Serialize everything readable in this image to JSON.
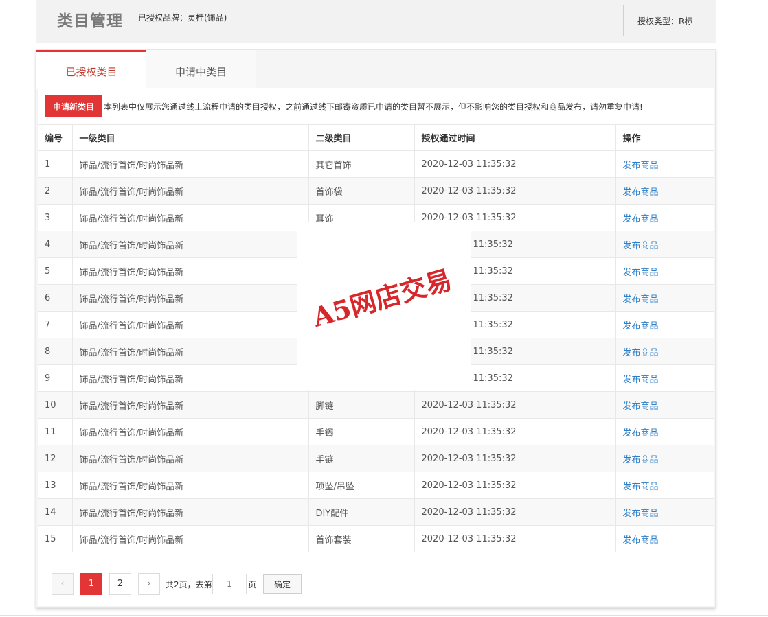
{
  "header": {
    "title": "类目管理",
    "brand": "已授权品牌：灵桂(饰品)",
    "auth_type": "授权类型：R标"
  },
  "tabs": [
    {
      "label": "已授权类目",
      "active": true
    },
    {
      "label": "申请中类目",
      "active": false
    }
  ],
  "toolbar": {
    "apply_label": "申请新类目",
    "notice": "本列表中仅展示您通过线上流程申请的类目授权，之前通过线下邮寄资质已申请的类目暂不展示，但不影响您的类目授权和商品发布，请勿重复申请!"
  },
  "table": {
    "columns": [
      "编号",
      "一级类目",
      "二级类目",
      "授权通过时间",
      "操作"
    ],
    "rows": [
      {
        "no": "1",
        "cat1": "饰品/流行首饰/时尚饰品新",
        "cat2": "其它首饰",
        "time": "2020-12-03 11:35:32",
        "action": "发布商品"
      },
      {
        "no": "2",
        "cat1": "饰品/流行首饰/时尚饰品新",
        "cat2": "首饰袋",
        "time": "2020-12-03 11:35:32",
        "action": "发布商品"
      },
      {
        "no": "3",
        "cat1": "饰品/流行首饰/时尚饰品新",
        "cat2": "耳饰",
        "time": "2020-12-03 11:35:32",
        "action": "发布商品"
      },
      {
        "no": "4",
        "cat1": "饰品/流行首饰/时尚饰品新",
        "cat2": "",
        "time": "11:35:32",
        "action": "发布商品"
      },
      {
        "no": "5",
        "cat1": "饰品/流行首饰/时尚饰品新",
        "cat2": "",
        "time": "11:35:32",
        "action": "发布商品"
      },
      {
        "no": "6",
        "cat1": "饰品/流行首饰/时尚饰品新",
        "cat2": "",
        "time": "11:35:32",
        "action": "发布商品"
      },
      {
        "no": "7",
        "cat1": "饰品/流行首饰/时尚饰品新",
        "cat2": "",
        "time": "11:35:32",
        "action": "发布商品"
      },
      {
        "no": "8",
        "cat1": "饰品/流行首饰/时尚饰品新",
        "cat2": "",
        "time": "11:35:32",
        "action": "发布商品"
      },
      {
        "no": "9",
        "cat1": "饰品/流行首饰/时尚饰品新",
        "cat2": "",
        "time": "11:35:32",
        "action": "发布商品"
      },
      {
        "no": "10",
        "cat1": "饰品/流行首饰/时尚饰品新",
        "cat2": "脚链",
        "time": "2020-12-03 11:35:32",
        "action": "发布商品"
      },
      {
        "no": "11",
        "cat1": "饰品/流行首饰/时尚饰品新",
        "cat2": "手镯",
        "time": "2020-12-03 11:35:32",
        "action": "发布商品"
      },
      {
        "no": "12",
        "cat1": "饰品/流行首饰/时尚饰品新",
        "cat2": "手链",
        "time": "2020-12-03 11:35:32",
        "action": "发布商品"
      },
      {
        "no": "13",
        "cat1": "饰品/流行首饰/时尚饰品新",
        "cat2": "项坠/吊坠",
        "time": "2020-12-03 11:35:32",
        "action": "发布商品"
      },
      {
        "no": "14",
        "cat1": "饰品/流行首饰/时尚饰品新",
        "cat2": "DIY配件",
        "time": "2020-12-03 11:35:32",
        "action": "发布商品"
      },
      {
        "no": "15",
        "cat1": "饰品/流行首饰/时尚饰品新",
        "cat2": "首饰套装",
        "time": "2020-12-03 11:35:32",
        "action": "发布商品"
      }
    ]
  },
  "watermark": "A5网店交易",
  "pagination": {
    "prev_icon": "‹",
    "next_icon": "›",
    "pages": [
      "1",
      "2"
    ],
    "current": "1",
    "total_label": "共2页，去第",
    "input_value": "1",
    "unit_label": "页",
    "confirm_label": "确定"
  },
  "colors": {
    "accent": "#e23535",
    "link": "#2d7fc7"
  }
}
